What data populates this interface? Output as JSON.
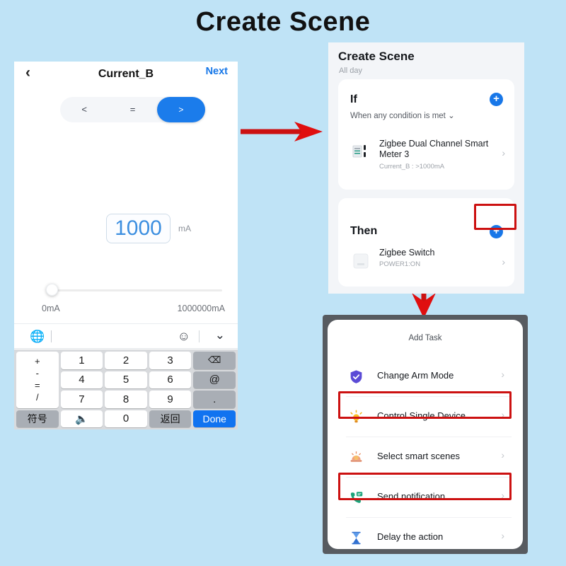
{
  "page": {
    "title": "Create Scene",
    "background_color": "#bfe3f6",
    "accent_color": "#1877e8",
    "highlight_color": "#cc1111"
  },
  "left_phone": {
    "navbar": {
      "back_icon": "chevron-left-icon",
      "title": "Current_B",
      "next_label": "Next"
    },
    "comparator": {
      "options": [
        "<",
        "=",
        ">"
      ],
      "selected": ">"
    },
    "value_input": {
      "value": "1000",
      "unit": "mA"
    },
    "slider": {
      "min_label": "0mA",
      "max_label": "1000000mA",
      "position_percent": 2
    },
    "input_bar": {
      "globe_icon": "globe-keyboard-icon",
      "emoji_icon": "emoji-smiley-icon",
      "collapse_icon": "chevron-down-icon"
    },
    "keyboard": {
      "operators": [
        "+",
        "-",
        "=",
        "/"
      ],
      "digits": [
        "1",
        "2",
        "3",
        "4",
        "5",
        "6",
        "7",
        "8",
        "9"
      ],
      "backspace_icon": "backspace-icon",
      "at_key": "@",
      "dot_key": ".",
      "symbols_key": "符号",
      "space_icon": "microphone-space-icon",
      "zero_key": "0",
      "return_key": "返回",
      "done_key": "Done"
    }
  },
  "scene_panel": {
    "title": "Create Scene",
    "subtitle": "All day",
    "if_card": {
      "heading": "If",
      "condition": "When any condition is met",
      "add_icon": "plus-circle-icon",
      "device": {
        "icon": "smart-meter-icon",
        "name": "Zigbee Dual Channel Smart Meter 3",
        "detail": "Current_B : >1000mA",
        "chevron": "chevron-right-icon"
      }
    },
    "then_card": {
      "heading": "Then",
      "add_icon": "plus-circle-icon",
      "device": {
        "icon": "zigbee-switch-icon",
        "name": "Zigbee Switch",
        "detail": "POWER1:ON",
        "chevron": "chevron-right-icon"
      }
    }
  },
  "add_task_panel": {
    "title": "Add Task",
    "items": [
      {
        "icon": "shield-check-icon",
        "label": "Change Arm Mode",
        "highlighted": false
      },
      {
        "icon": "light-bulb-icon",
        "label": "Control Single Device",
        "highlighted": true
      },
      {
        "icon": "sunrise-scene-icon",
        "label": "Select smart scenes",
        "highlighted": false
      },
      {
        "icon": "phone-message-icon",
        "label": "Send notification",
        "highlighted": true
      },
      {
        "icon": "hourglass-icon",
        "label": "Delay the action",
        "highlighted": false
      }
    ]
  },
  "arrows": {
    "right_arrow": "red-arrow-right",
    "down_arrow": "red-arrow-down",
    "color": "#cc1111"
  }
}
